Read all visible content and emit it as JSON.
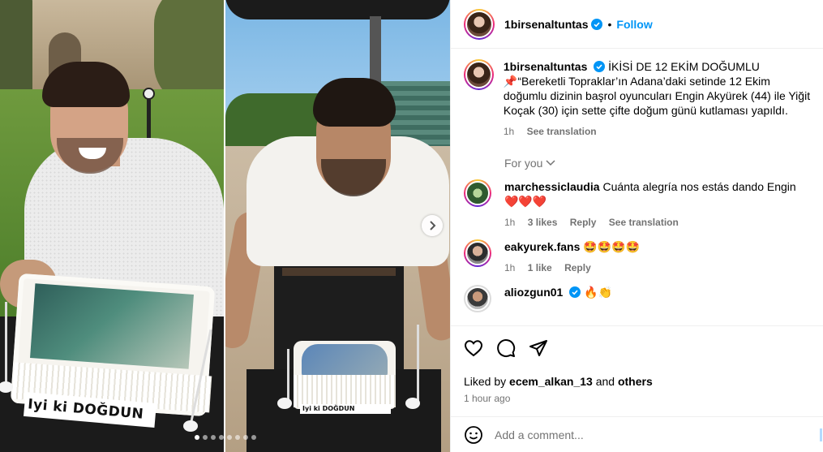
{
  "colors": {
    "accent": "#0095f6",
    "secondary_text": "#737373",
    "like_heart": "#ed4956"
  },
  "media": {
    "left_cake_text": "Iyi ki DOĞDUN",
    "right_cake_text": "Iyi ki DOĞDUN",
    "carousel_dots": 8,
    "active_dot": 0
  },
  "header": {
    "username": "1birsenaltuntas",
    "separator": "•",
    "follow_label": "Follow"
  },
  "caption": {
    "username": "1birsenaltuntas",
    "title": "İKİSİ DE 12 EKİM DOĞUMLU",
    "pin_emoji": "📌",
    "text": "“Bereketli Topraklar’ın Adana’daki setinde 12 Ekim doğumlu dizinin başrol oyuncuları Engin Akyürek (44) ile Yiğit Koçak (30) için sette çifte doğum günü kutlaması yapıldı.",
    "time": "1h",
    "see_translation": "See translation"
  },
  "for_you_label": "For you",
  "comments": [
    {
      "username": "marchessiclaudia",
      "text": "Cuánta alegría nos estás dando Engin ❤️❤️❤️",
      "time": "1h",
      "likes": "3 likes",
      "reply": "Reply",
      "see_translation": "See translation"
    },
    {
      "username": "eakyurek.fans",
      "text": "🤩🤩🤩🤩",
      "time": "1h",
      "likes": "1 like",
      "reply": "Reply"
    },
    {
      "username": "aliozgun01",
      "text": "🔥👏"
    }
  ],
  "actions": {
    "liked_by_prefix": "Liked by",
    "liked_by_user": "ecem_alkan_13",
    "liked_by_and": "and",
    "liked_by_others": "others",
    "time_ago": "1 hour ago"
  },
  "add_comment": {
    "placeholder": "Add a comment..."
  }
}
